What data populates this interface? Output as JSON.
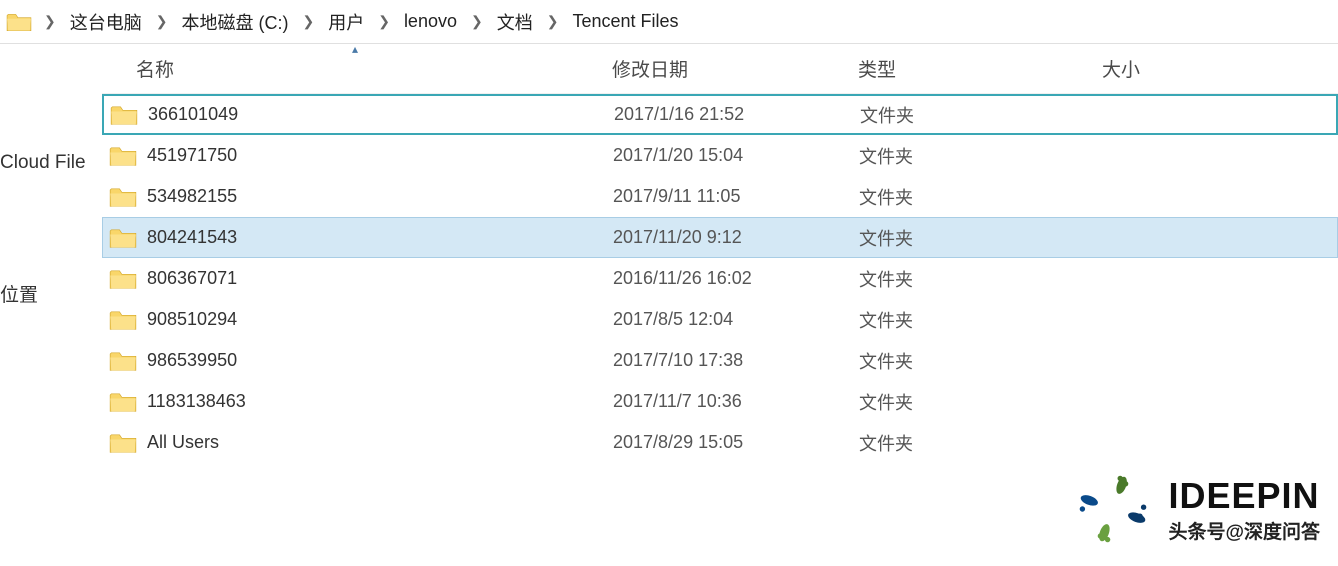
{
  "breadcrumb": [
    "这台电脑",
    "本地磁盘 (C:)",
    "用户",
    "lenovo",
    "文档",
    "Tencent Files"
  ],
  "headers": {
    "name": "名称",
    "date": "修改日期",
    "type": "类型",
    "size": "大小"
  },
  "sidebar": {
    "item0": "Cloud File",
    "item1": "位置"
  },
  "rows": [
    {
      "name": "366101049",
      "date": "2017/1/16 21:52",
      "type": "文件夹",
      "state": "focused"
    },
    {
      "name": "451971750",
      "date": "2017/1/20 15:04",
      "type": "文件夹",
      "state": ""
    },
    {
      "name": "534982155",
      "date": "2017/9/11 11:05",
      "type": "文件夹",
      "state": ""
    },
    {
      "name": "804241543",
      "date": "2017/11/20 9:12",
      "type": "文件夹",
      "state": "selected"
    },
    {
      "name": "806367071",
      "date": "2016/11/26 16:02",
      "type": "文件夹",
      "state": ""
    },
    {
      "name": "908510294",
      "date": "2017/8/5 12:04",
      "type": "文件夹",
      "state": ""
    },
    {
      "name": "986539950",
      "date": "2017/7/10 17:38",
      "type": "文件夹",
      "state": ""
    },
    {
      "name": "1183138463",
      "date": "2017/11/7 10:36",
      "type": "文件夹",
      "state": ""
    },
    {
      "name": "All Users",
      "date": "2017/8/29 15:05",
      "type": "文件夹",
      "state": ""
    }
  ],
  "watermark": {
    "brand": "IDEEPIN",
    "sub": "头条号@深度问答"
  }
}
